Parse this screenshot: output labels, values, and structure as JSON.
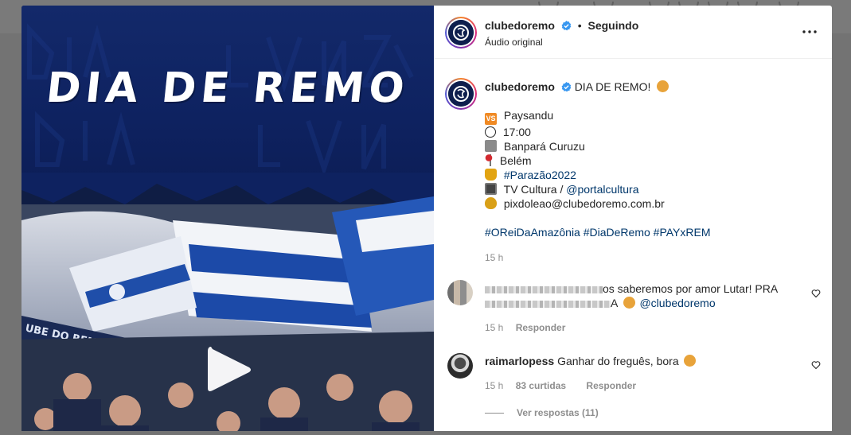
{
  "post": {
    "media": {
      "headline": "DIA DE REMO"
    },
    "header": {
      "username": "clubedoremo",
      "separator": "•",
      "follow_state": "Seguindo",
      "audio": "Áudio original"
    },
    "caption": {
      "username": "clubedoremo",
      "text": "DIA DE REMO!",
      "opponent": "Paysandu",
      "time": "17:00",
      "stadium": "Banpará Curuzu",
      "city": "Belém",
      "tournament_tag": "#Parazão2022",
      "tv_prefix": "TV Cultura / ",
      "tv_handle": "@portalcultura",
      "pix": "pixdoleao@clubedoremo.com.br",
      "hashtags": [
        "#OReiDaAmazônia",
        "#DiaDeRemo",
        "#PAYxREM"
      ],
      "timestamp": "15 h"
    },
    "comments": [
      {
        "text_visible": "os saberemos por amor Lutar! PRA",
        "text_visible_2": "A",
        "mention": "@clubedoremo",
        "timestamp": "15 h",
        "reply_label": "Responder"
      },
      {
        "username": "raimarlopess",
        "text": "Ganhar do freguês, bora",
        "timestamp": "15 h",
        "likes": "83 curtidas",
        "reply_label": "Responder",
        "view_replies": "Ver respostas (11)"
      }
    ]
  },
  "icons": {
    "verified": "verified-badge-icon",
    "more": "more-options-icon",
    "play": "play-icon",
    "heart": "heart-icon"
  },
  "colors": {
    "accent_link": "#00376b",
    "verified_blue": "#3897f0",
    "club_navy": "#0e1e4d"
  }
}
